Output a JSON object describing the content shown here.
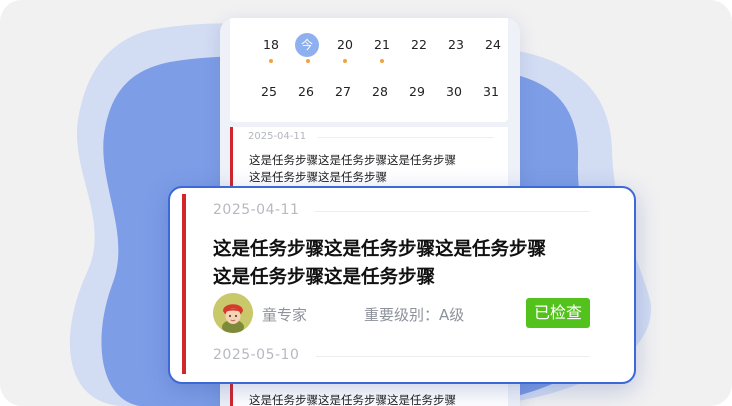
{
  "calendar": {
    "week1": [
      "18",
      "今",
      "20",
      "21",
      "22",
      "23",
      "24"
    ],
    "week2": [
      "25",
      "26",
      "27",
      "28",
      "29",
      "30",
      "31"
    ],
    "marker_color": "#f4a23a",
    "today_color": "#8fb0ee"
  },
  "tasks": [
    {
      "date": "2025-04-11",
      "text_line1": "这是任务步骤这是任务步骤这是任务步骤",
      "text_line2": "这是任务步骤这是任务步骤"
    },
    {
      "date": "2025-05-10",
      "text_line1": "这是任务步骤这是任务步骤这是任务步骤"
    }
  ],
  "featured": {
    "date": "2025-04-11",
    "title_line1": "这是任务步骤这是任务步骤这是任务步骤",
    "title_line2": "这是任务步骤这是任务步骤",
    "author": "童专家",
    "importance": "重要级别：A级",
    "status": "已检查",
    "next_date": "2025-05-10",
    "accent_color": "#d0262c",
    "status_color": "#53c21c",
    "border_color": "#3c68d8"
  }
}
